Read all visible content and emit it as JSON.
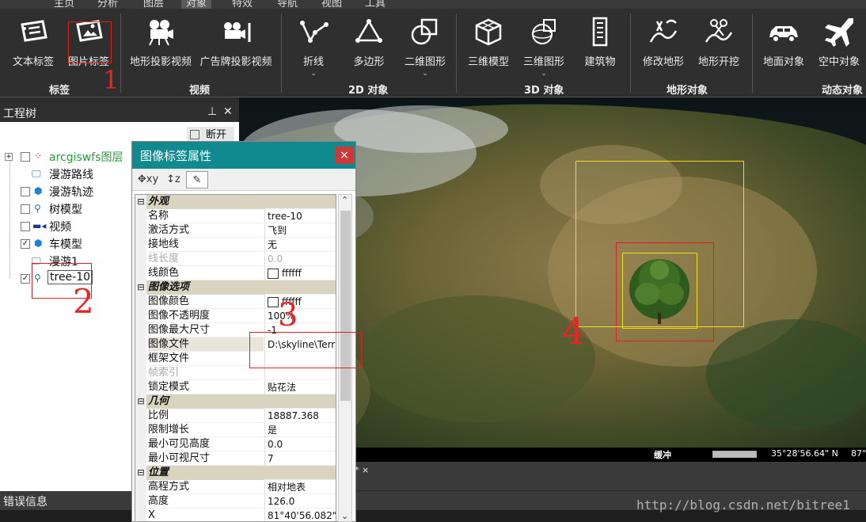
{
  "ribbon": {
    "tabs": [
      "主页",
      "分析",
      "图层",
      "对象",
      "特效",
      "导航",
      "视图",
      "工具"
    ],
    "active_tab": "对象",
    "buttons": [
      {
        "label": "文本标签",
        "icon": "text-label-icon"
      },
      {
        "label": "图片标签",
        "icon": "image-label-icon"
      },
      {
        "label": "地形投影视频",
        "icon": "video-camera-icon"
      },
      {
        "label": "广告牌投影视频",
        "icon": "billboard-video-icon"
      },
      {
        "label": "折线",
        "icon": "polyline-icon"
      },
      {
        "label": "多边形",
        "icon": "polygon-icon"
      },
      {
        "label": "二维图形",
        "icon": "2d-shape-icon"
      },
      {
        "label": "三维模型",
        "icon": "3d-model-icon"
      },
      {
        "label": "三维图形",
        "icon": "3d-shape-icon"
      },
      {
        "label": "建筑物",
        "icon": "building-icon"
      },
      {
        "label": "修改地形",
        "icon": "modify-terrain-icon"
      },
      {
        "label": "地形开挖",
        "icon": "terrain-excavate-icon"
      },
      {
        "label": "地面对象",
        "icon": "car-icon"
      },
      {
        "label": "空中对象",
        "icon": "airplane-icon"
      }
    ],
    "groups": [
      "标签",
      "视频",
      "2D 对象",
      "3D 对象",
      "地形对象",
      "动态对象"
    ]
  },
  "panel": {
    "title": "工程树",
    "pin": "⊥",
    "close": "✕",
    "disconnect": "断开"
  },
  "tree": [
    {
      "label": "arcgiswfs图层",
      "checked": false,
      "icon": "wfs-layer-icon",
      "color": "#2a9a3a"
    },
    {
      "label": "漫游路线",
      "checked": null,
      "icon": "route-icon",
      "color": "#111"
    },
    {
      "label": "漫游轨迹",
      "checked": false,
      "icon": "track-icon",
      "color": "#111"
    },
    {
      "label": "树模型",
      "checked": false,
      "icon": "pin-icon",
      "color": "#111"
    },
    {
      "label": "视频",
      "checked": false,
      "icon": "video-icon",
      "color": "#111"
    },
    {
      "label": "车模型",
      "checked": true,
      "icon": "model-icon",
      "color": "#111"
    },
    {
      "label": "漫游1",
      "checked": null,
      "icon": "route-icon",
      "color": "#111"
    },
    {
      "label": "tree-10",
      "checked": true,
      "icon": "pin-icon",
      "color": "#111"
    }
  ],
  "dialog": {
    "title": "图像标签属性",
    "close": "×",
    "tools": [
      "✥xy",
      "↕z",
      "✎"
    ],
    "rows": [
      {
        "type": "cat",
        "name": "外观"
      },
      {
        "name": "名称",
        "value": "tree-10"
      },
      {
        "name": "激活方式",
        "value": "飞到"
      },
      {
        "name": "接地线",
        "value": "无"
      },
      {
        "name": "线长度",
        "value": "0.0",
        "dim": true
      },
      {
        "name": "线颜色",
        "value": "ffffff",
        "swatch": true
      },
      {
        "type": "cat",
        "name": "图像选项"
      },
      {
        "name": "图像颜色",
        "value": "ffffff",
        "swatch": true
      },
      {
        "name": "图像不透明度",
        "value": "100%"
      },
      {
        "name": "图像最大尺寸",
        "value": "-1"
      },
      {
        "name": "图像文件",
        "value": "D:\\skyline\\Terra",
        "sel": true
      },
      {
        "name": "框架文件",
        "value": ""
      },
      {
        "name": "帧索引",
        "value": "",
        "dim": true
      },
      {
        "name": "锁定模式",
        "value": "贴花法"
      },
      {
        "type": "cat",
        "name": "几何"
      },
      {
        "name": "比例",
        "value": "18887.368"
      },
      {
        "name": "限制增长",
        "value": "是"
      },
      {
        "name": "最小可见高度",
        "value": "0.0"
      },
      {
        "name": "最小可视尺寸",
        "value": "7"
      },
      {
        "type": "cat",
        "name": "位置"
      },
      {
        "name": "高程方式",
        "value": "相对地表"
      },
      {
        "name": "高度",
        "value": "126.0"
      },
      {
        "name": "X",
        "value": "81°40'56.082\""
      }
    ]
  },
  "status": {
    "buffer": "缓冲",
    "lat": "35°28'56.64\" N",
    "lon": "87°"
  },
  "bottom": {
    "tab_marker": "* ×",
    "error_title": "错误信息"
  },
  "annotations": {
    "n1": "1",
    "n2": "2",
    "n3": "3",
    "n4": "4"
  },
  "watermark": "http://blog.csdn.net/bitree1"
}
